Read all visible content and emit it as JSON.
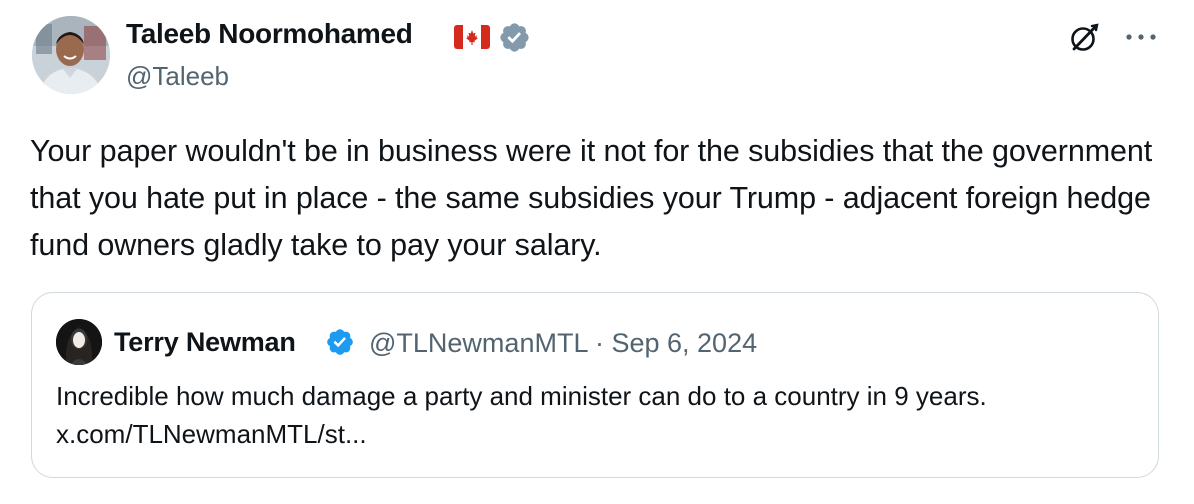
{
  "author": {
    "name": "Taleeb Noormohamed",
    "handle": "@Taleeb",
    "flag_icon": "canada-flag-icon",
    "verified": true
  },
  "header_actions": {
    "grok_icon": "grok-icon",
    "more_icon": "more-icon"
  },
  "tweet": {
    "text": "Your paper wouldn't be in business were it not for the subsidies that the government that you hate put in place - the same subsidies your Trump - adjacent foreign hedge fund owners gladly take to pay your salary."
  },
  "quoted_tweet": {
    "name": "Terry Newman",
    "handle": "@TLNewmanMTL",
    "separator": "·",
    "date": "Sep 6, 2024",
    "verified": true,
    "text": "Incredible how much damage a party and minister can do to a country in 9 years. x.com/TLNewmanMTL/st..."
  },
  "colors": {
    "text_primary": "#0f1419",
    "text_secondary": "#536471",
    "verified_author": "#829aab",
    "verified_quoted": "#1d9bf0",
    "border": "#cfd9de",
    "flag_red": "#d52b1e"
  }
}
